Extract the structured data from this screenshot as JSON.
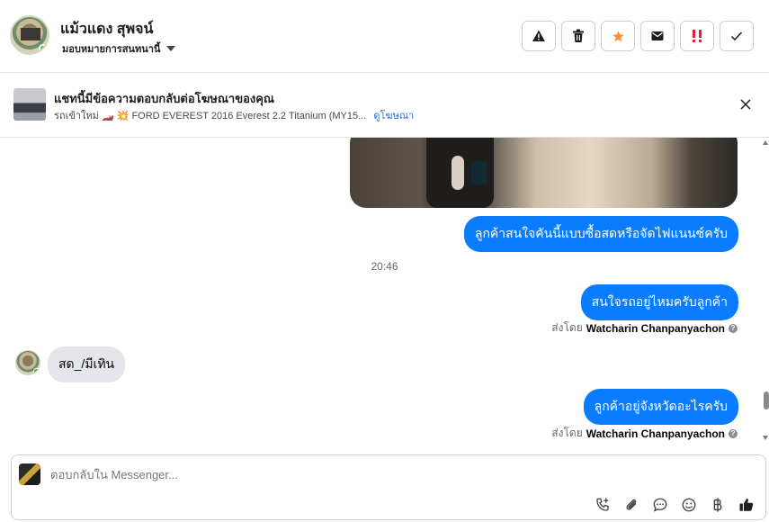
{
  "header": {
    "name": "แม้วแดง สุพจน์",
    "assign_label": "มอบหมายการสนทนานี้",
    "actions": [
      {
        "icon": "warning-icon",
        "label": ""
      },
      {
        "icon": "trash-icon",
        "label": ""
      },
      {
        "icon": "star-icon",
        "label": ""
      },
      {
        "icon": "envelope-icon",
        "label": ""
      },
      {
        "icon": "follow-up-icon",
        "label": ""
      },
      {
        "icon": "check-icon",
        "label": ""
      }
    ],
    "colors": {
      "star": "#f7923b",
      "followup": "#e41e3f"
    }
  },
  "ad_banner": {
    "title": "แชทนี้มีข้อความตอบกลับต่อโฆษณาของคุณ",
    "subtitle": "รถเข้าใหม่ 🏎️ 💥 FORD EVEREST 2016 Everest 2.2 Titanium (MY15...",
    "link": "ดูโฆษณา"
  },
  "messages": {
    "out1": "ลูกค้าสนใจคันนี้แบบซื้อสดหรือจัดไฟแนนซ์ครับ",
    "time": "20:46",
    "out2": "สนใจรถอยู่ไหมครับลูกค้า",
    "sent_by_prefix": "ส่งโดย",
    "sent_by_name": "Watcharin Chanpanyachon",
    "in1": "สด_/มีเทิน",
    "out3": "ลูกค้าอยู่จังหวัดอะไรครับ"
  },
  "composer": {
    "placeholder": "ตอบกลับใน Messenger...",
    "tools": [
      "call-add-icon",
      "attachment-icon",
      "saved-reply-icon",
      "emoji-icon",
      "baht-icon",
      "like-icon"
    ]
  },
  "colors": {
    "accent": "#0a7cff",
    "incoming_bubble": "#e4e6eb"
  }
}
